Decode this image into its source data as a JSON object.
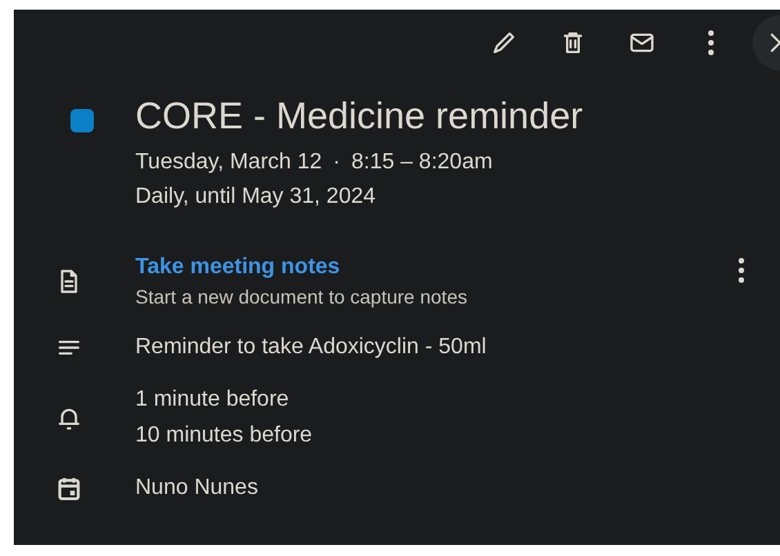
{
  "toolbar": [
    {
      "kind": "edit"
    },
    {
      "kind": "delete"
    },
    {
      "kind": "email"
    },
    {
      "kind": "more"
    },
    {
      "kind": "close"
    }
  ],
  "event": {
    "title": "CORE - Medicine reminder",
    "color": "#0b7fc7",
    "date": "Tuesday, March 12",
    "separator": "·",
    "time": "8:15 – 8:20am",
    "recurrence": "Daily, until May 31, 2024"
  },
  "details": [
    {
      "kind": "notes",
      "link": "Take meeting notes",
      "subtitle": "Start a new document to capture notes"
    },
    {
      "kind": "description",
      "lines": [
        "Reminder to take Adoxicyclin - 50ml"
      ]
    },
    {
      "kind": "notifications",
      "lines": [
        "1 minute before",
        "10 minutes before"
      ]
    },
    {
      "kind": "calendar",
      "lines": [
        "Nuno Nunes"
      ]
    }
  ]
}
